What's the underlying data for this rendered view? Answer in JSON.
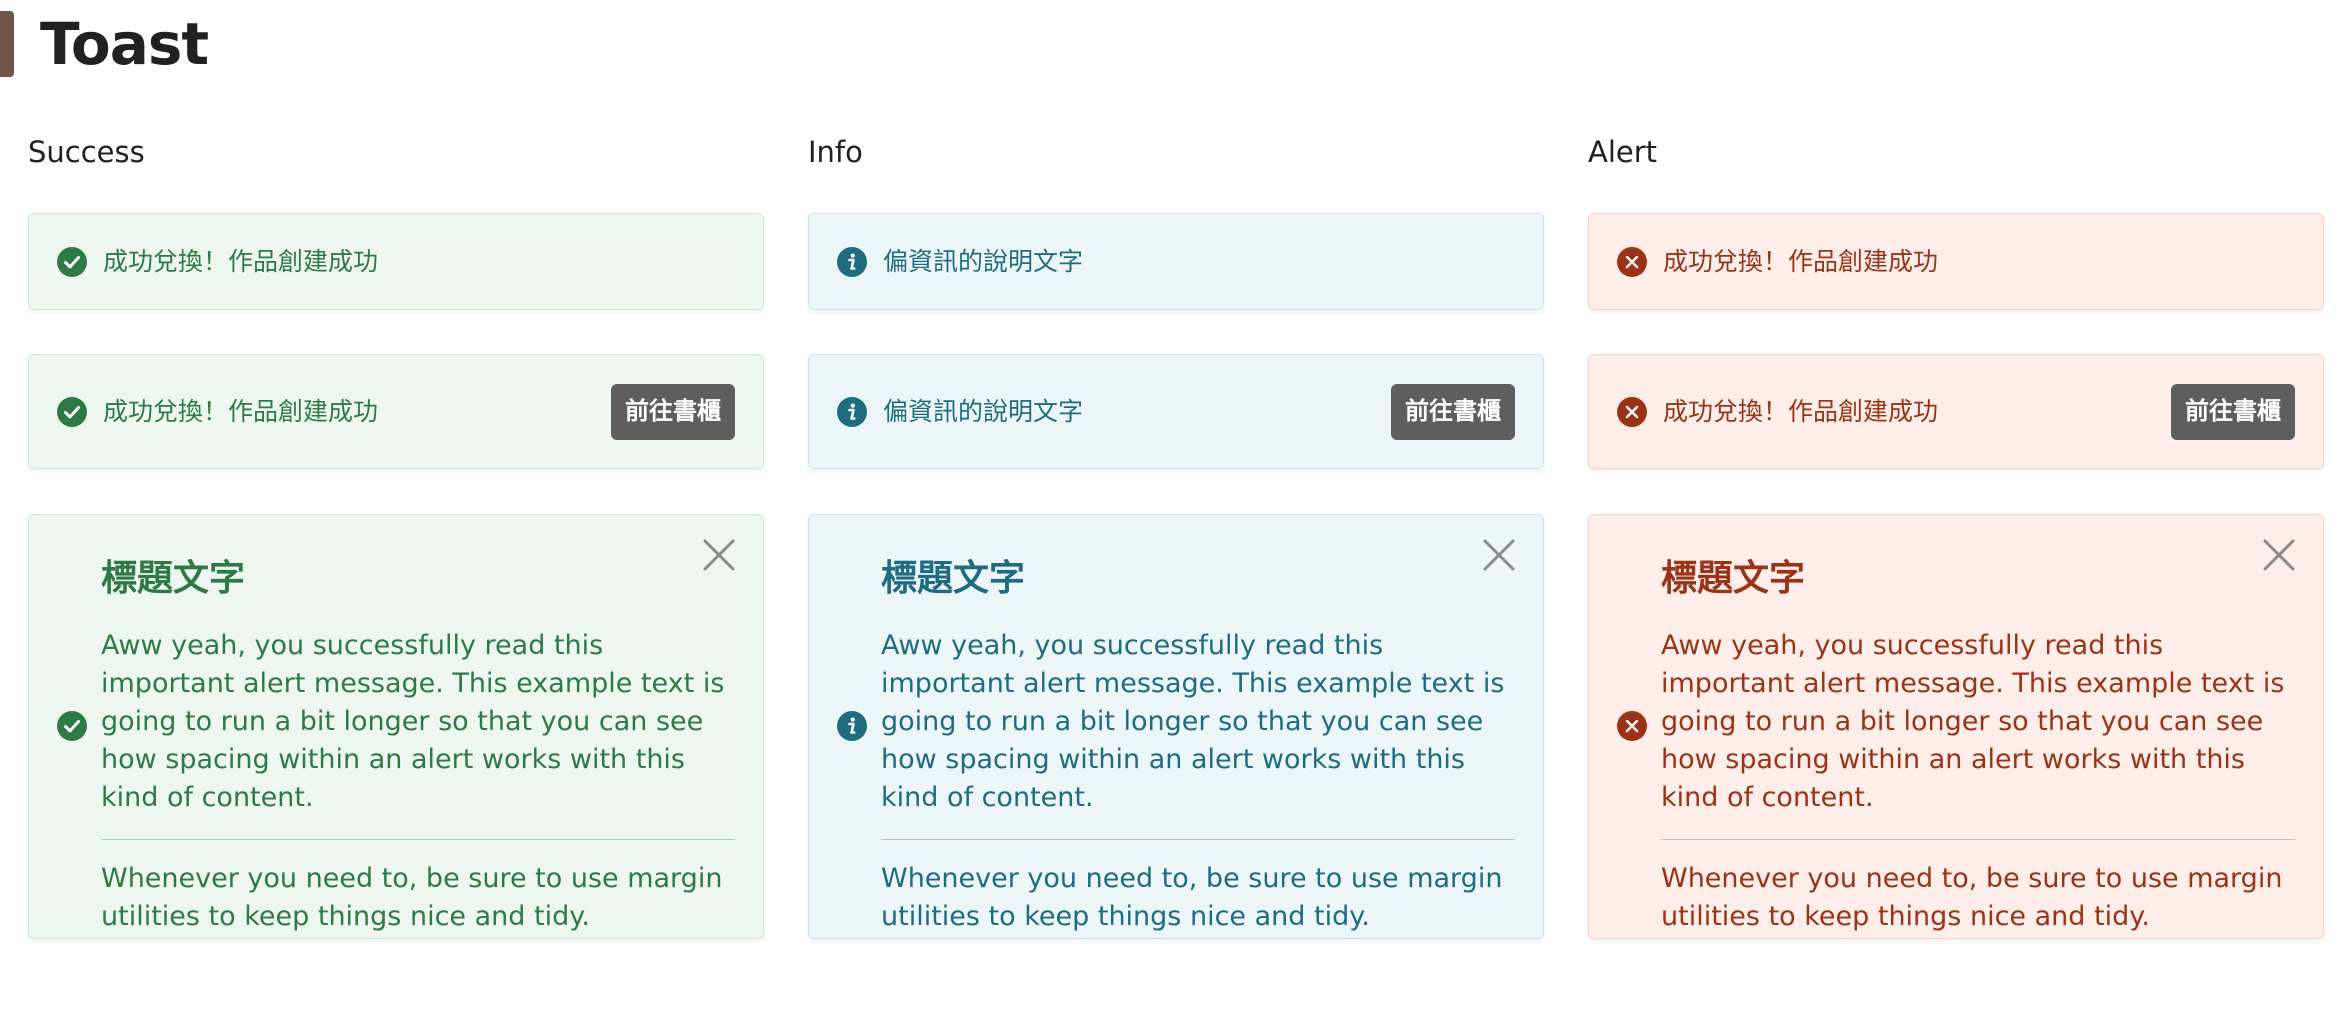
{
  "page": {
    "title": "Toast"
  },
  "columns": [
    {
      "label": "Success",
      "icon": "check-circle-icon",
      "simple_text": "成功兌換！作品創建成功",
      "action_text": "成功兌換！作品創建成功",
      "action_button": "前往書櫃",
      "detail_title": "標題文字",
      "detail_message": "Aww yeah, you successfully read this important alert message. This example text is going to run a bit longer so that you can see how spacing within an alert works with this kind of content.",
      "detail_note": "Whenever you need to, be sure to use margin utilities to keep things nice and tidy.",
      "color": "#2e7a47",
      "background": "#edf7ef"
    },
    {
      "label": "Info",
      "icon": "info-circle-icon",
      "simple_text": "偏資訊的說明文字",
      "action_text": "偏資訊的說明文字",
      "action_button": "前往書櫃",
      "detail_title": "標題文字",
      "detail_message": "Aww yeah, you successfully read this important alert message. This example text is going to run a bit longer so that you can see how spacing within an alert works with this kind of content.",
      "detail_note": "Whenever you need to, be sure to use margin utilities to keep things nice and tidy.",
      "color": "#1f6b80",
      "background": "#ecf6f9"
    },
    {
      "label": "Alert",
      "icon": "x-circle-icon",
      "simple_text": "成功兌換！作品創建成功",
      "action_text": "成功兌換！作品創建成功",
      "action_button": "前往書櫃",
      "detail_title": "標題文字",
      "detail_message": "Aww yeah, you successfully read this important alert message. This example text is going to run a bit longer so that you can see how spacing within an alert works with this kind of content.",
      "detail_note": "Whenever you need to, be sure to use margin utilities to keep things nice and tidy.",
      "color": "#9a3318",
      "background": "#fdeee9"
    }
  ],
  "colors": {
    "header_bar": "#6f5447",
    "action_button_bg": "#5e5e5e",
    "close_icon": "#8a8a8a"
  }
}
